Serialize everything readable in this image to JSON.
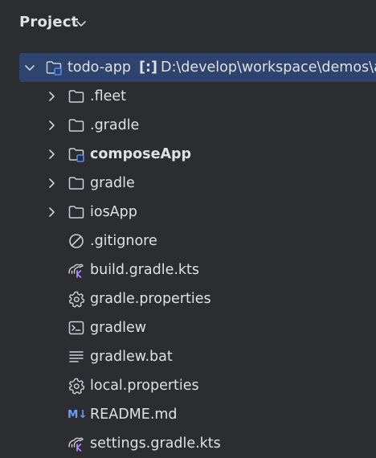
{
  "header": {
    "title": "Project"
  },
  "root": {
    "name": "todo-app",
    "tag": "[:]",
    "path": "D:\\develop\\workspace\\demos\\a"
  },
  "items": [
    {
      "label": ".fleet",
      "icon": "folder-icon"
    },
    {
      "label": ".gradle",
      "icon": "folder-icon"
    },
    {
      "label": "composeApp",
      "icon": "module-folder-icon"
    },
    {
      "label": "gradle",
      "icon": "folder-icon"
    },
    {
      "label": "iosApp",
      "icon": "folder-icon"
    },
    {
      "label": ".gitignore",
      "icon": "ignored-file-icon"
    },
    {
      "label": "build.gradle.kts",
      "icon": "gradle-kotlin-icon"
    },
    {
      "label": "gradle.properties",
      "icon": "settings-gear-icon"
    },
    {
      "label": "gradlew",
      "icon": "terminal-icon"
    },
    {
      "label": "gradlew.bat",
      "icon": "text-file-icon"
    },
    {
      "label": "local.properties",
      "icon": "settings-gear-icon"
    },
    {
      "label": "README.md",
      "icon": "markdown-icon",
      "icon_text": "M↓"
    },
    {
      "label": "settings.gradle.kts",
      "icon": "gradle-kotlin-icon"
    }
  ],
  "colors": {
    "background": "#2b2d30",
    "selection": "#2e436e",
    "text": "#dfe1e5",
    "icon": "#ced0d6",
    "module_badge": "#548af7",
    "kotlin_accent": "#b489f5",
    "markdown": "#6b9bfa"
  }
}
